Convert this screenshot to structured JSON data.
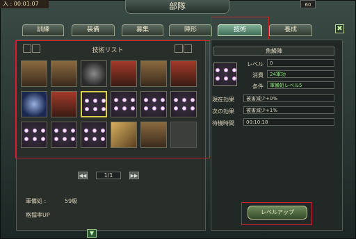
{
  "header": {
    "timer": "入 : 00:01:07",
    "title": "部隊",
    "level_badge": "60"
  },
  "tabs": [
    {
      "label": "訓練"
    },
    {
      "label": "装備"
    },
    {
      "label": "募集"
    },
    {
      "label": "陣形"
    },
    {
      "label": "技術",
      "active": true
    },
    {
      "label": "養成"
    }
  ],
  "close_icon": "✖",
  "tech_list": {
    "title": "技術リスト",
    "cells": [
      {
        "icon": "unit-icon"
      },
      {
        "icon": "unit-icon"
      },
      {
        "icon": "crossed-swords-icon"
      },
      {
        "icon": "unit-red-icon"
      },
      {
        "icon": "cavalry-icon"
      },
      {
        "icon": "unit-red-icon"
      },
      {
        "icon": "fan-icon"
      },
      {
        "icon": "unit-red-icon"
      },
      {
        "icon": "formation-dots-icon",
        "selected": true
      },
      {
        "icon": "formation-dots-icon"
      },
      {
        "icon": "formation-dots-icon"
      },
      {
        "icon": "formation-dots-icon"
      },
      {
        "icon": "formation-dots-icon"
      },
      {
        "icon": "formation-dots-icon"
      },
      {
        "icon": "formation-dots-icon"
      },
      {
        "icon": "scroll-icon"
      },
      {
        "icon": "general-icon"
      },
      {
        "icon": "empty"
      }
    ]
  },
  "pager": {
    "prev": "◀◀",
    "page": "1/1",
    "next": "▶▶"
  },
  "footer": {
    "rank_label": "軍備処 :",
    "rank_value": "59級",
    "bonus_text": "格擋率UP"
  },
  "detail": {
    "name": "魚鱗陣",
    "level_label": "レベル",
    "level_value": "0",
    "cost_label": "消費",
    "cost_value": "24軍功",
    "condition_label": "条件",
    "condition_value": "軍備処レベル5",
    "current_effect_label": "現在効果",
    "current_effect_value": "被害減少+0%",
    "next_effect_label": "次の効果",
    "next_effect_value": "被害減少+1%",
    "wait_label": "待機時間",
    "wait_value": "00:10:18",
    "levelup_label": "レベルアップ"
  },
  "colors": {
    "highlight": "#d2202a",
    "green_text": "#8ee87a",
    "active_tab": "#5f9478"
  }
}
